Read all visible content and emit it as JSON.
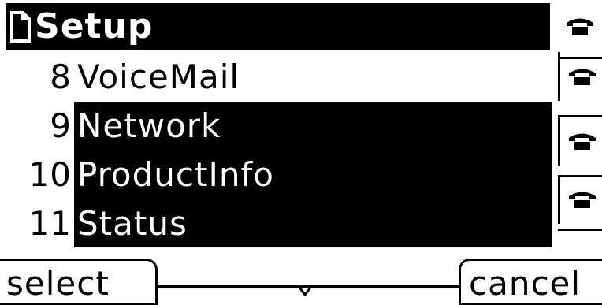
{
  "title_bar": {
    "icon": "document-icon",
    "title": "Setup"
  },
  "menu": {
    "items": [
      {
        "number": "8",
        "label": "VoiceMail",
        "selected": true
      },
      {
        "number": "9",
        "label": "Network",
        "selected": false
      },
      {
        "number": "10",
        "label": "ProductInfo",
        "selected": false
      },
      {
        "number": "11",
        "label": "Status",
        "selected": false
      }
    ]
  },
  "line_keys": [
    {
      "icon": "phone-icon"
    },
    {
      "icon": "phone-icon"
    },
    {
      "icon": "phone-icon"
    },
    {
      "icon": "phone-icon"
    },
    {
      "icon": "phone-icon"
    }
  ],
  "softkeys": {
    "left": "select",
    "right": "cancel"
  },
  "colors": {
    "foreground": "#000000",
    "background": "#ffffff"
  }
}
